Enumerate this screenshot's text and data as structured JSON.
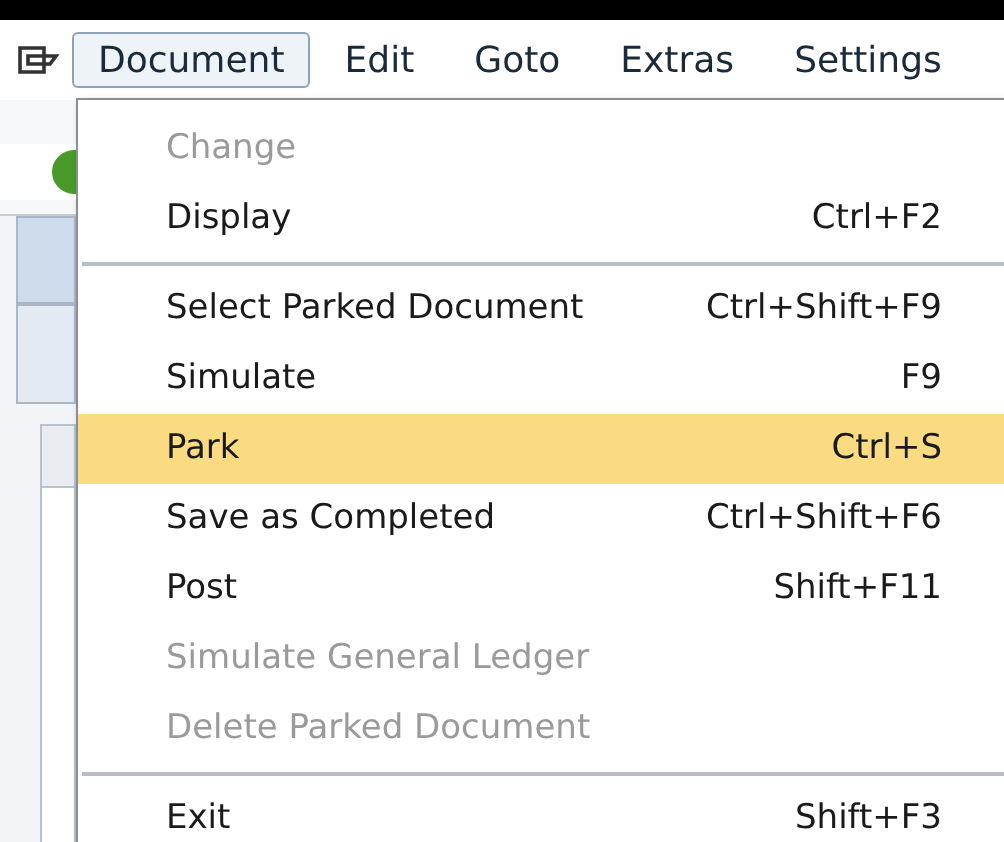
{
  "menu_bar": {
    "items": [
      {
        "label": "Document",
        "selected": true
      },
      {
        "label": "Edit",
        "selected": false
      },
      {
        "label": "Goto",
        "selected": false
      },
      {
        "label": "Extras",
        "selected": false
      },
      {
        "label": "Settings",
        "selected": false
      }
    ]
  },
  "dropdown": {
    "items": [
      {
        "kind": "item",
        "label": "Change",
        "disabled": true,
        "selected": false
      },
      {
        "kind": "item",
        "label": "Display",
        "shortcut": "Ctrl+F2",
        "disabled": false,
        "selected": false
      },
      {
        "kind": "separator"
      },
      {
        "kind": "item",
        "label": "Select Parked Document",
        "shortcut": "Ctrl+Shift+F9",
        "disabled": false,
        "selected": false
      },
      {
        "kind": "item",
        "label": "Simulate",
        "shortcut": "F9",
        "disabled": false,
        "selected": false
      },
      {
        "kind": "item",
        "label": "Park",
        "shortcut": "Ctrl+S",
        "disabled": false,
        "selected": true
      },
      {
        "kind": "item",
        "label": "Save as Completed",
        "shortcut": "Ctrl+Shift+F6",
        "disabled": false,
        "selected": false
      },
      {
        "kind": "item",
        "label": "Post",
        "shortcut": "Shift+F11",
        "disabled": false,
        "selected": false
      },
      {
        "kind": "item",
        "label": "Simulate General Ledger",
        "disabled": true,
        "selected": false
      },
      {
        "kind": "item",
        "label": "Delete Parked Document",
        "disabled": true,
        "selected": false
      },
      {
        "kind": "separator"
      },
      {
        "kind": "item",
        "label": "Exit",
        "shortcut": "Shift+F3",
        "disabled": false,
        "selected": false
      }
    ]
  }
}
